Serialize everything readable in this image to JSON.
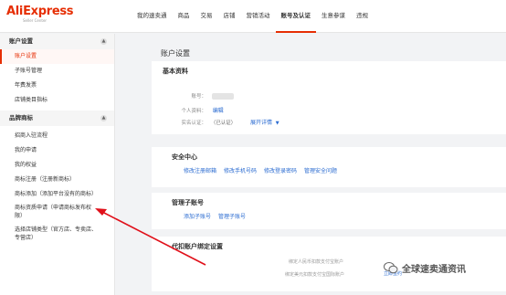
{
  "logo": {
    "name": "AliExpress",
    "tagline": "Seller Center"
  },
  "nav": [
    "我的速卖通",
    "商品",
    "交易",
    "店铺",
    "营销活动",
    "账号及认证",
    "生意参谋",
    "违规"
  ],
  "nav_active_index": 5,
  "sidebar": {
    "group1": "账户设置",
    "group1_items": [
      "账户设置",
      "子账号管理",
      "年费发票",
      "店铺类目指标"
    ],
    "group2": "品牌商标",
    "group2_items": [
      "招商入驻流程",
      "我的申请",
      "我的权益",
      "商标注册（注册新商标）",
      "商标添加（添加平台没有的商标）",
      "商标资质申请（申请商标发布权限）",
      "选择店铺类型（官方店、专卖店、专营店）"
    ]
  },
  "main": {
    "title": "账户设置",
    "basic": {
      "title": "基本资料",
      "account_label": "账号：",
      "personal_label": "个人资料：",
      "personal_link": "编辑",
      "verify_label": "实名认证：",
      "verify_value": "（已认证）",
      "verify_link": "展开详情"
    },
    "security": {
      "title": "安全中心",
      "links": [
        "修改注册邮箱",
        "修改手机号码",
        "修改登录密码",
        "管理安全问题"
      ]
    },
    "sub": {
      "title": "管理子账号",
      "links": [
        "添加子账号",
        "管理子账号"
      ]
    },
    "payment": {
      "title": "代扣账户绑定设置",
      "row1": "绑定人民币扣款支付宝账户",
      "row2": "绑定美元扣款支付宝国际账户",
      "row2_link": "立即签约"
    }
  },
  "watermark": "全球速卖通资讯",
  "colors": {
    "brand": "#e62e04",
    "link": "#2a6bd1",
    "arrow": "#e0101a"
  }
}
